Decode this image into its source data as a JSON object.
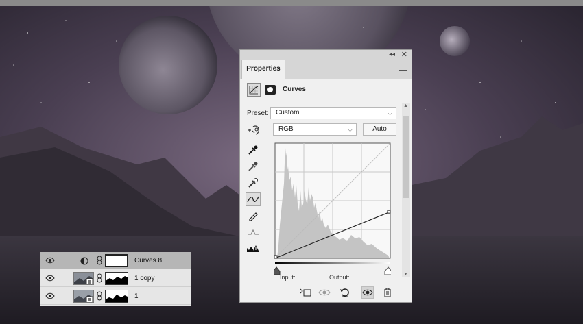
{
  "panel": {
    "tab_label": "Properties",
    "adjustment_title": "Curves",
    "preset_label": "Preset:",
    "preset_value": "Custom",
    "channel_value": "RGB",
    "auto_label": "Auto",
    "input_label": "Input:",
    "output_label": "Output:",
    "tools": [
      "eyedropper-black-icon",
      "eyedropper-gray-icon",
      "eyedropper-white-icon",
      "curve-points-icon",
      "pencil-icon",
      "smooth-icon",
      "clipping-warning-icon"
    ],
    "bottom_icons": [
      "clip-to-layer-icon",
      "view-previous-state-icon",
      "reset-icon",
      "visibility-icon",
      "delete-icon"
    ]
  },
  "curve": {
    "black_point": {
      "input": 0,
      "output": 0
    },
    "white_point": {
      "input": 255,
      "output": 103
    }
  },
  "layers": [
    {
      "name": "Curves 8",
      "type": "adjustment",
      "visible": true,
      "selected": true
    },
    {
      "name": "1 copy",
      "type": "smart-object",
      "visible": true,
      "selected": false
    },
    {
      "name": "1",
      "type": "smart-object",
      "visible": true,
      "selected": false
    }
  ],
  "colors": {
    "panel_bg": "#f0f0f0",
    "layer_selected": "#b6b6b6",
    "sky_dark": "#2a2530",
    "sky_purple": "#5a4a60"
  }
}
